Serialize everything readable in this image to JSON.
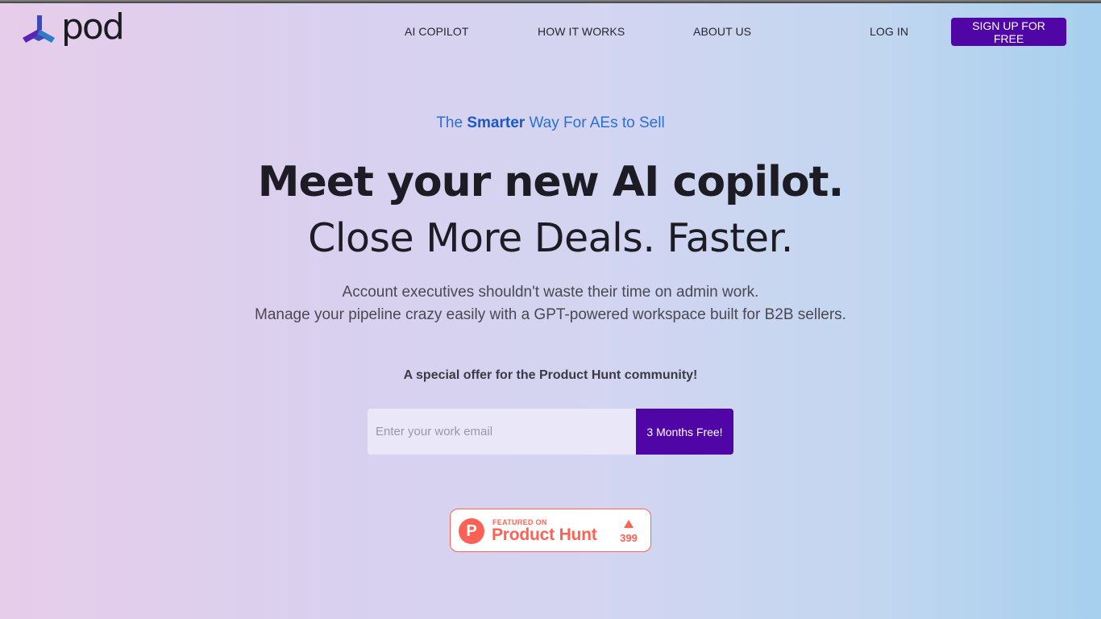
{
  "brand": {
    "name": "pod",
    "icon": "pod-logo-icon",
    "colors": {
      "primary": "#5006a6",
      "tagline": "#2a6fd6",
      "product_hunt": "#ff6154"
    }
  },
  "nav": {
    "links": [
      "AI COPILOT",
      "HOW IT WORKS",
      "ABOUT US"
    ],
    "login": "LOG IN",
    "signup": "SIGN UP FOR FREE"
  },
  "hero": {
    "tagline_pre": "The ",
    "tagline_bold": "Smarter",
    "tagline_post": " Way For AEs to Sell",
    "headline": "Meet your new AI copilot.",
    "subheadline": "Close More Deals. Faster.",
    "description_1": "Account executives shouldn't waste their time on admin work.",
    "description_2": "Manage your pipeline crazy easily with a GPT-powered workspace built for B2B sellers.",
    "offer": "A special offer for the Product Hunt community!"
  },
  "signup_form": {
    "email_placeholder": "Enter your work email",
    "email_value": "",
    "button": "3 Months Free!"
  },
  "product_hunt_badge": {
    "featured": "FEATURED ON",
    "name": "Product Hunt",
    "letter": "P",
    "upvote_icon": "upvote-arrow-icon",
    "count": "399"
  }
}
